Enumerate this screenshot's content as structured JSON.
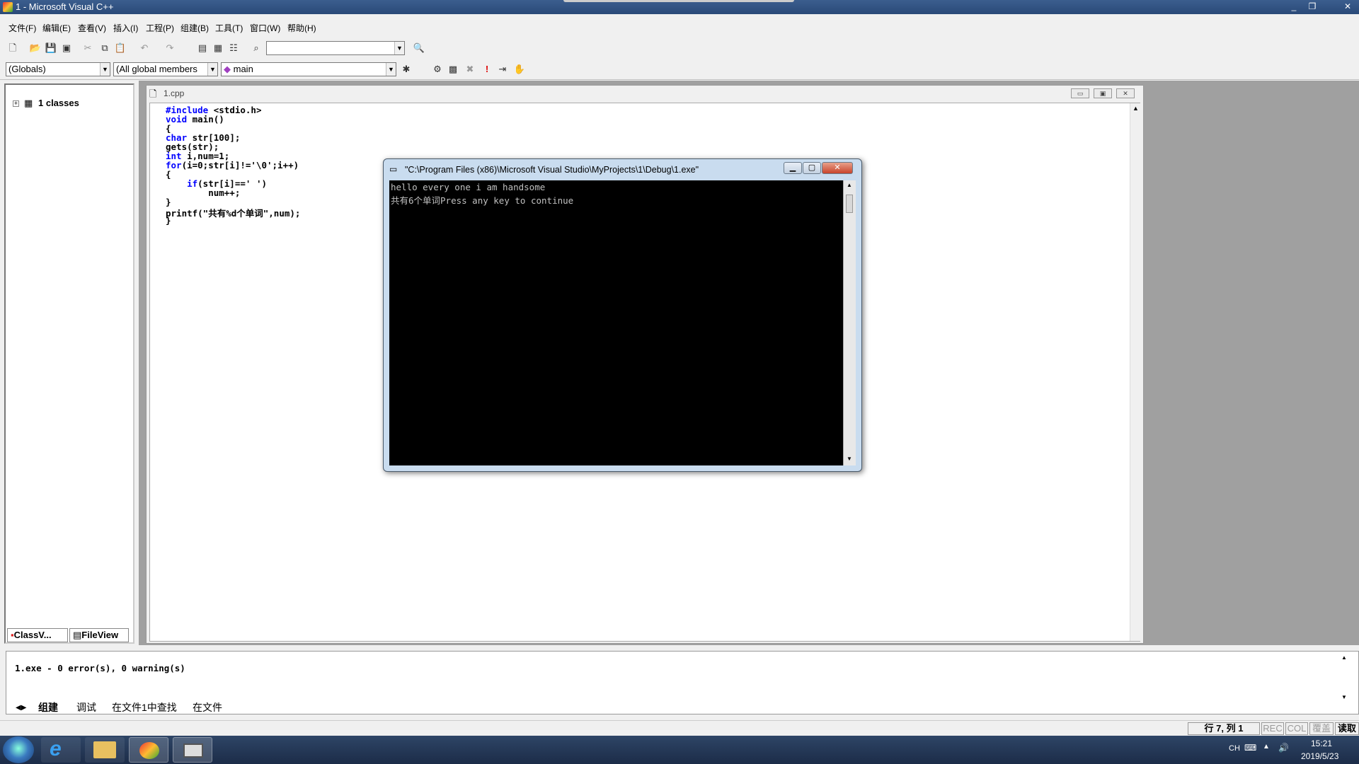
{
  "window": {
    "title": "1 - Microsoft Visual C++",
    "controls": [
      "_",
      "❐",
      "✕"
    ]
  },
  "menu": [
    "文件(F)",
    "编辑(E)",
    "查看(V)",
    "插入(I)",
    "工程(P)",
    "组建(B)",
    "工具(T)",
    "窗口(W)",
    "帮助(H)"
  ],
  "toolbar": {
    "find_combo_value": "",
    "scope_combo": "(Globals)",
    "members_combo": "(All global members",
    "function_combo": "main"
  },
  "workspace": {
    "tree_root": "1 classes",
    "tabs": [
      "ClassV...",
      "FileView"
    ]
  },
  "editor": {
    "filename": "1.cpp",
    "code": [
      {
        "kw": "#include",
        "rest": " <stdio.h>"
      },
      {
        "kw": "void",
        "rest": " main()"
      },
      {
        "kw": "",
        "rest": "{"
      },
      {
        "kw": "char",
        "rest": " str[100];"
      },
      {
        "kw": "",
        "rest": "gets(str);"
      },
      {
        "kw": "int",
        "rest": " i,num=1;"
      },
      {
        "kw": "for",
        "rest": "(i=0;str[i]!='\\0';i++)"
      },
      {
        "kw": "",
        "rest": "{"
      },
      {
        "kw": "    if",
        "rest": "(str[i]==' ')"
      },
      {
        "kw": "",
        "rest": "        num++;"
      },
      {
        "kw": "",
        "rest": "}"
      },
      {
        "kw": "",
        "rest": "printf(\"共有%d个单词\",num);"
      },
      {
        "kw": "",
        "rest": "}"
      }
    ]
  },
  "console": {
    "title": "\"C:\\Program Files (x86)\\Microsoft Visual Studio\\MyProjects\\1\\Debug\\1.exe\"",
    "lines": [
      "hello every one i am handsome",
      "共有6个单词Press any key to continue"
    ]
  },
  "output": {
    "text": "1.exe - 0 error(s), 0 warning(s)",
    "tabs": [
      "组建",
      "调试",
      "在文件1中查找",
      "在文件"
    ]
  },
  "statusbar": {
    "position": "行 7, 列 1",
    "rec": "REC",
    "col": "COL",
    "ovr": "覆盖",
    "read": "读取"
  },
  "taskbar": {
    "lang": "CH",
    "time": "15:21",
    "date": "2019/5/23"
  },
  "colors": {
    "keyword": "#0000ff",
    "console_bg": "#000000",
    "console_text": "#c0c0c0",
    "mdi_bg": "#a0a0a0"
  }
}
